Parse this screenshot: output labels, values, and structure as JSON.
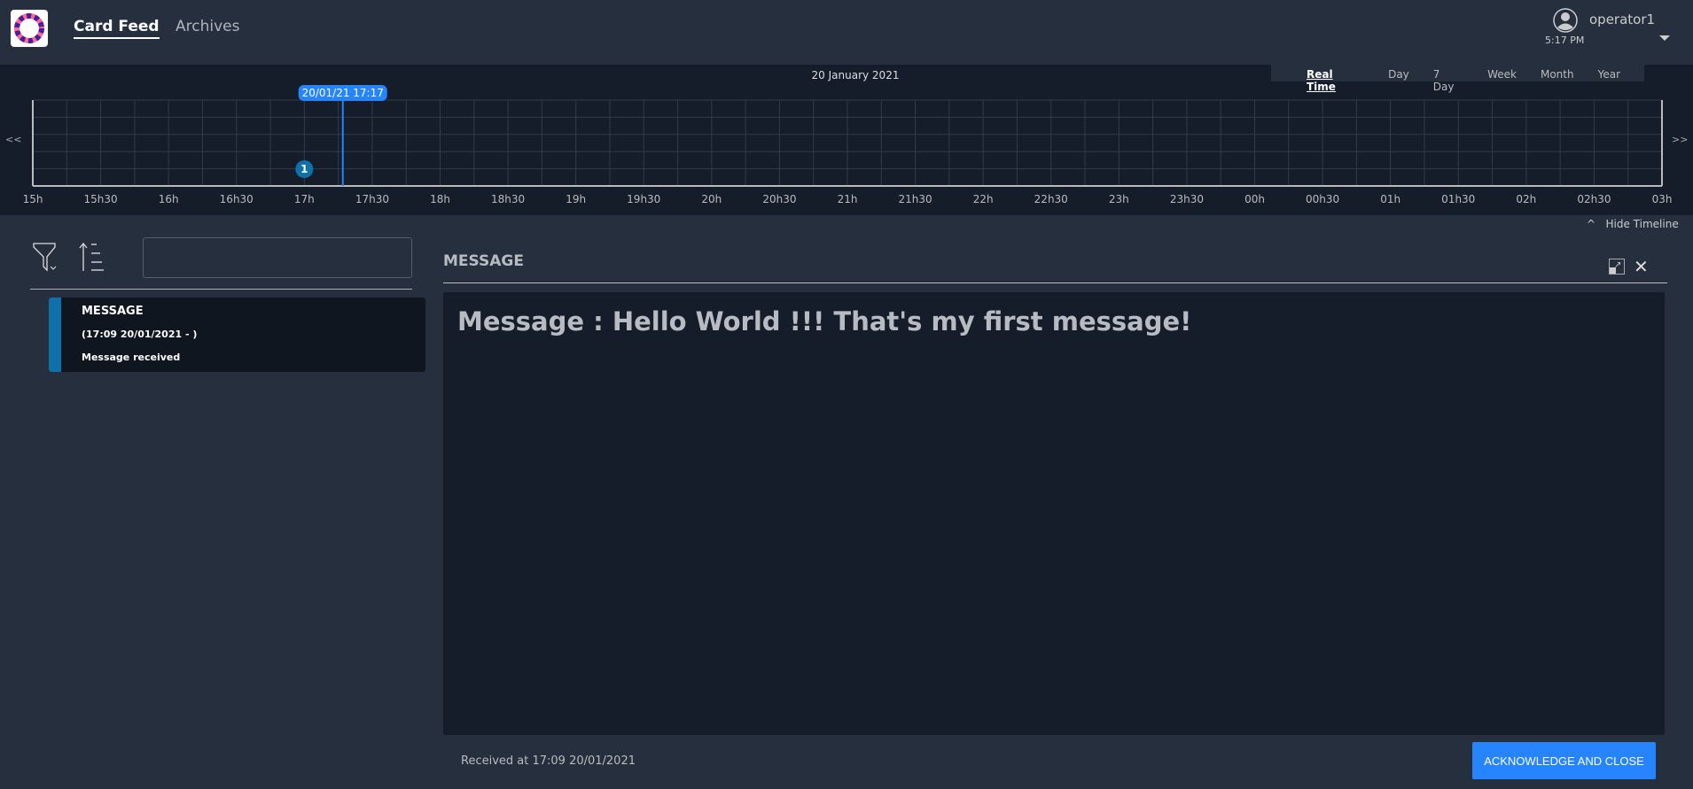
{
  "header": {
    "nav": [
      {
        "label": "Card Feed",
        "active": true
      },
      {
        "label": "Archives"
      }
    ],
    "user": {
      "name": "operator1",
      "time": "5:17 PM"
    }
  },
  "timeline": {
    "date": "20 January 2021",
    "periods": [
      "Real Time",
      "Day",
      "7 Day",
      "Week",
      "Month",
      "Year"
    ],
    "active_period": "Real Time",
    "prev": "<<",
    "next": ">>",
    "ticks": [
      "15h",
      "15h30",
      "16h",
      "16h30",
      "17h",
      "17h30",
      "18h",
      "18h30",
      "19h",
      "19h30",
      "20h",
      "20h30",
      "21h",
      "21h30",
      "22h",
      "22h30",
      "23h",
      "23h30",
      "00h",
      "00h30",
      "01h",
      "01h30",
      "02h",
      "02h30",
      "03h"
    ],
    "now_label": "20/01/21 17:17",
    "now_time": "17:17",
    "bubbles": [
      {
        "time": "17:00",
        "count": "1"
      }
    ],
    "hide_label": "Hide Timeline",
    "accent": "#2684ff",
    "bubble_color": "#0e71a9"
  },
  "feed": {
    "search_value": "",
    "cards": [
      {
        "title": "MESSAGE",
        "date": "(17:09 20/01/2021 - )",
        "summary": "Message received",
        "color": "#0e71a9"
      }
    ]
  },
  "detail": {
    "title": "MESSAGE",
    "message": "Message : Hello World !!! That's my first message!",
    "received": "Received at 17:09 20/01/2021",
    "ack_label": "ACKNOWLEDGE AND CLOSE"
  }
}
